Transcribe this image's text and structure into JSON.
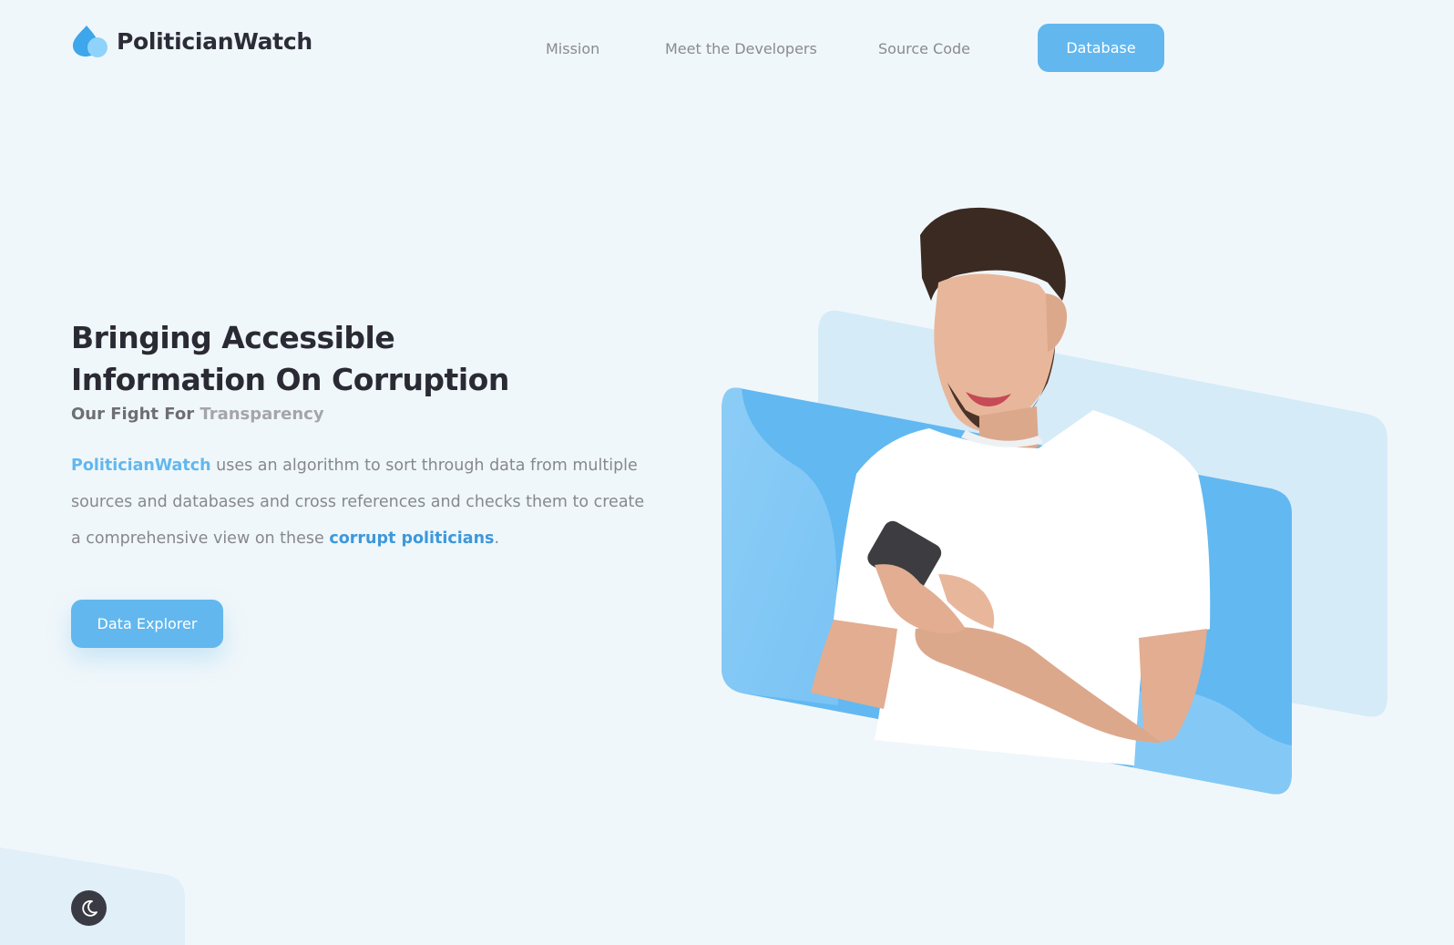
{
  "brand": {
    "name": "PoliticianWatch",
    "logo_icon": "water-drops-icon"
  },
  "nav": {
    "links": [
      "Mission",
      "Meet the Developers",
      "Source Code"
    ],
    "cta": "Database"
  },
  "hero": {
    "title_line1": "Bringing Accessible",
    "title_line2": "Information On Corruption",
    "subtitle_prefix": "Our Fight For",
    "subtitle_accent": "Transparency",
    "desc_brand": "PoliticianWatch",
    "desc_mid": "uses an algorithm to sort through data from multiple sources and databases and cross references and checks them to create a comprehensive view on these",
    "desc_highlight": "corrupt politicians",
    "desc_end": ".",
    "cta": "Data Explorer"
  },
  "theme_toggle": {
    "icon": "moon-icon"
  },
  "colors": {
    "accent": "#62b7ee",
    "background": "#f0f7fa",
    "heading": "#2a2a34",
    "body_text": "#878790"
  }
}
